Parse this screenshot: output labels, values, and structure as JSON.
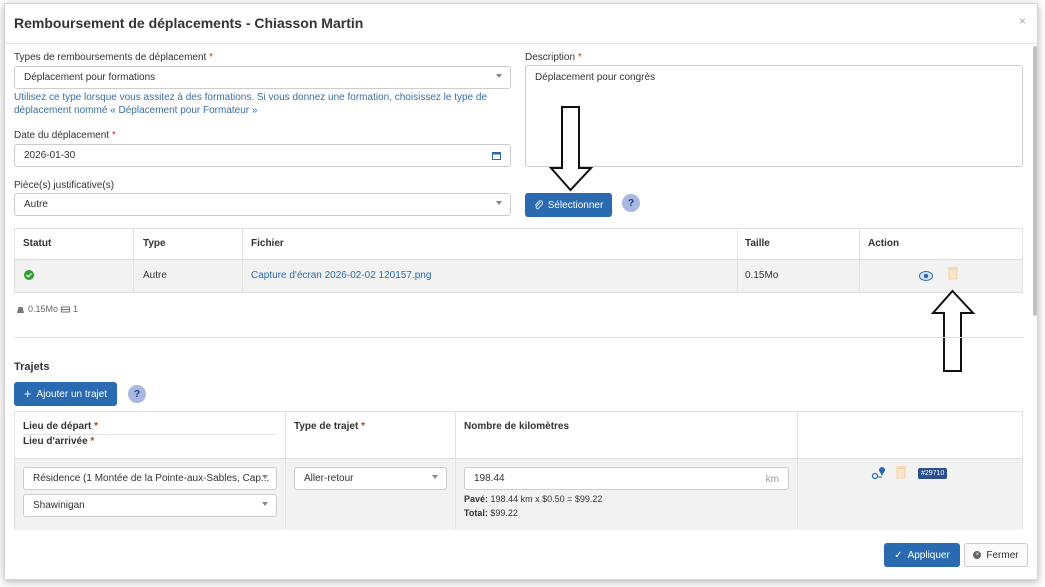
{
  "modal": {
    "title": "Remboursement de déplacements - Chiasson Martin",
    "close": "×"
  },
  "form": {
    "types_label": "Types de remboursements de déplacement",
    "req": "*",
    "types_value": "Déplacement pour formations",
    "types_help": "Utilisez ce type lorsque vous assitez à des formations. Si vous donnez une formation, choisissez le type de déplacement nommé « Déplacement pour Formateur »",
    "date_label": "Date du déplacement",
    "date_value": "2026-01-30",
    "pieces_label": "Pièce(s) justificative(s)",
    "pieces_value": "Autre",
    "desc_label": "Description",
    "desc_value": "Déplacement pour congrès",
    "select_button": "Sélectionner",
    "help_q": "?"
  },
  "files_table": {
    "headers": [
      "Statut",
      "Type",
      "Fichier",
      "Taille",
      "Action"
    ],
    "rows": [
      {
        "type": "Autre",
        "file": "Capture d'écran 2026-02-02 120157.png",
        "size": "0.15Mo"
      }
    ],
    "summary_size": "0.15Mo",
    "summary_count": "1"
  },
  "trips": {
    "title": "Trajets",
    "add_button": "Ajouter un trajet",
    "h_depart": "Lieu de départ",
    "h_arrivee": "Lieu d'arrivée",
    "h_type": "Type de trajet",
    "h_km": "Nombre de kilomètres",
    "depart": "Résidence (1 Montée de la Pointe-aux-Sables, Cap...",
    "arrivee": "Shawinigan",
    "type": "Aller-retour",
    "km": "198.44",
    "km_unit": "km",
    "pave_label": "Pavé:",
    "pave_value": "198.44 km x $0.50 = $99.22",
    "total_label": "Total:",
    "total_value": "$99.22",
    "badge": "#29710"
  },
  "footer": {
    "apply": "Appliquer",
    "close": "Fermer"
  }
}
